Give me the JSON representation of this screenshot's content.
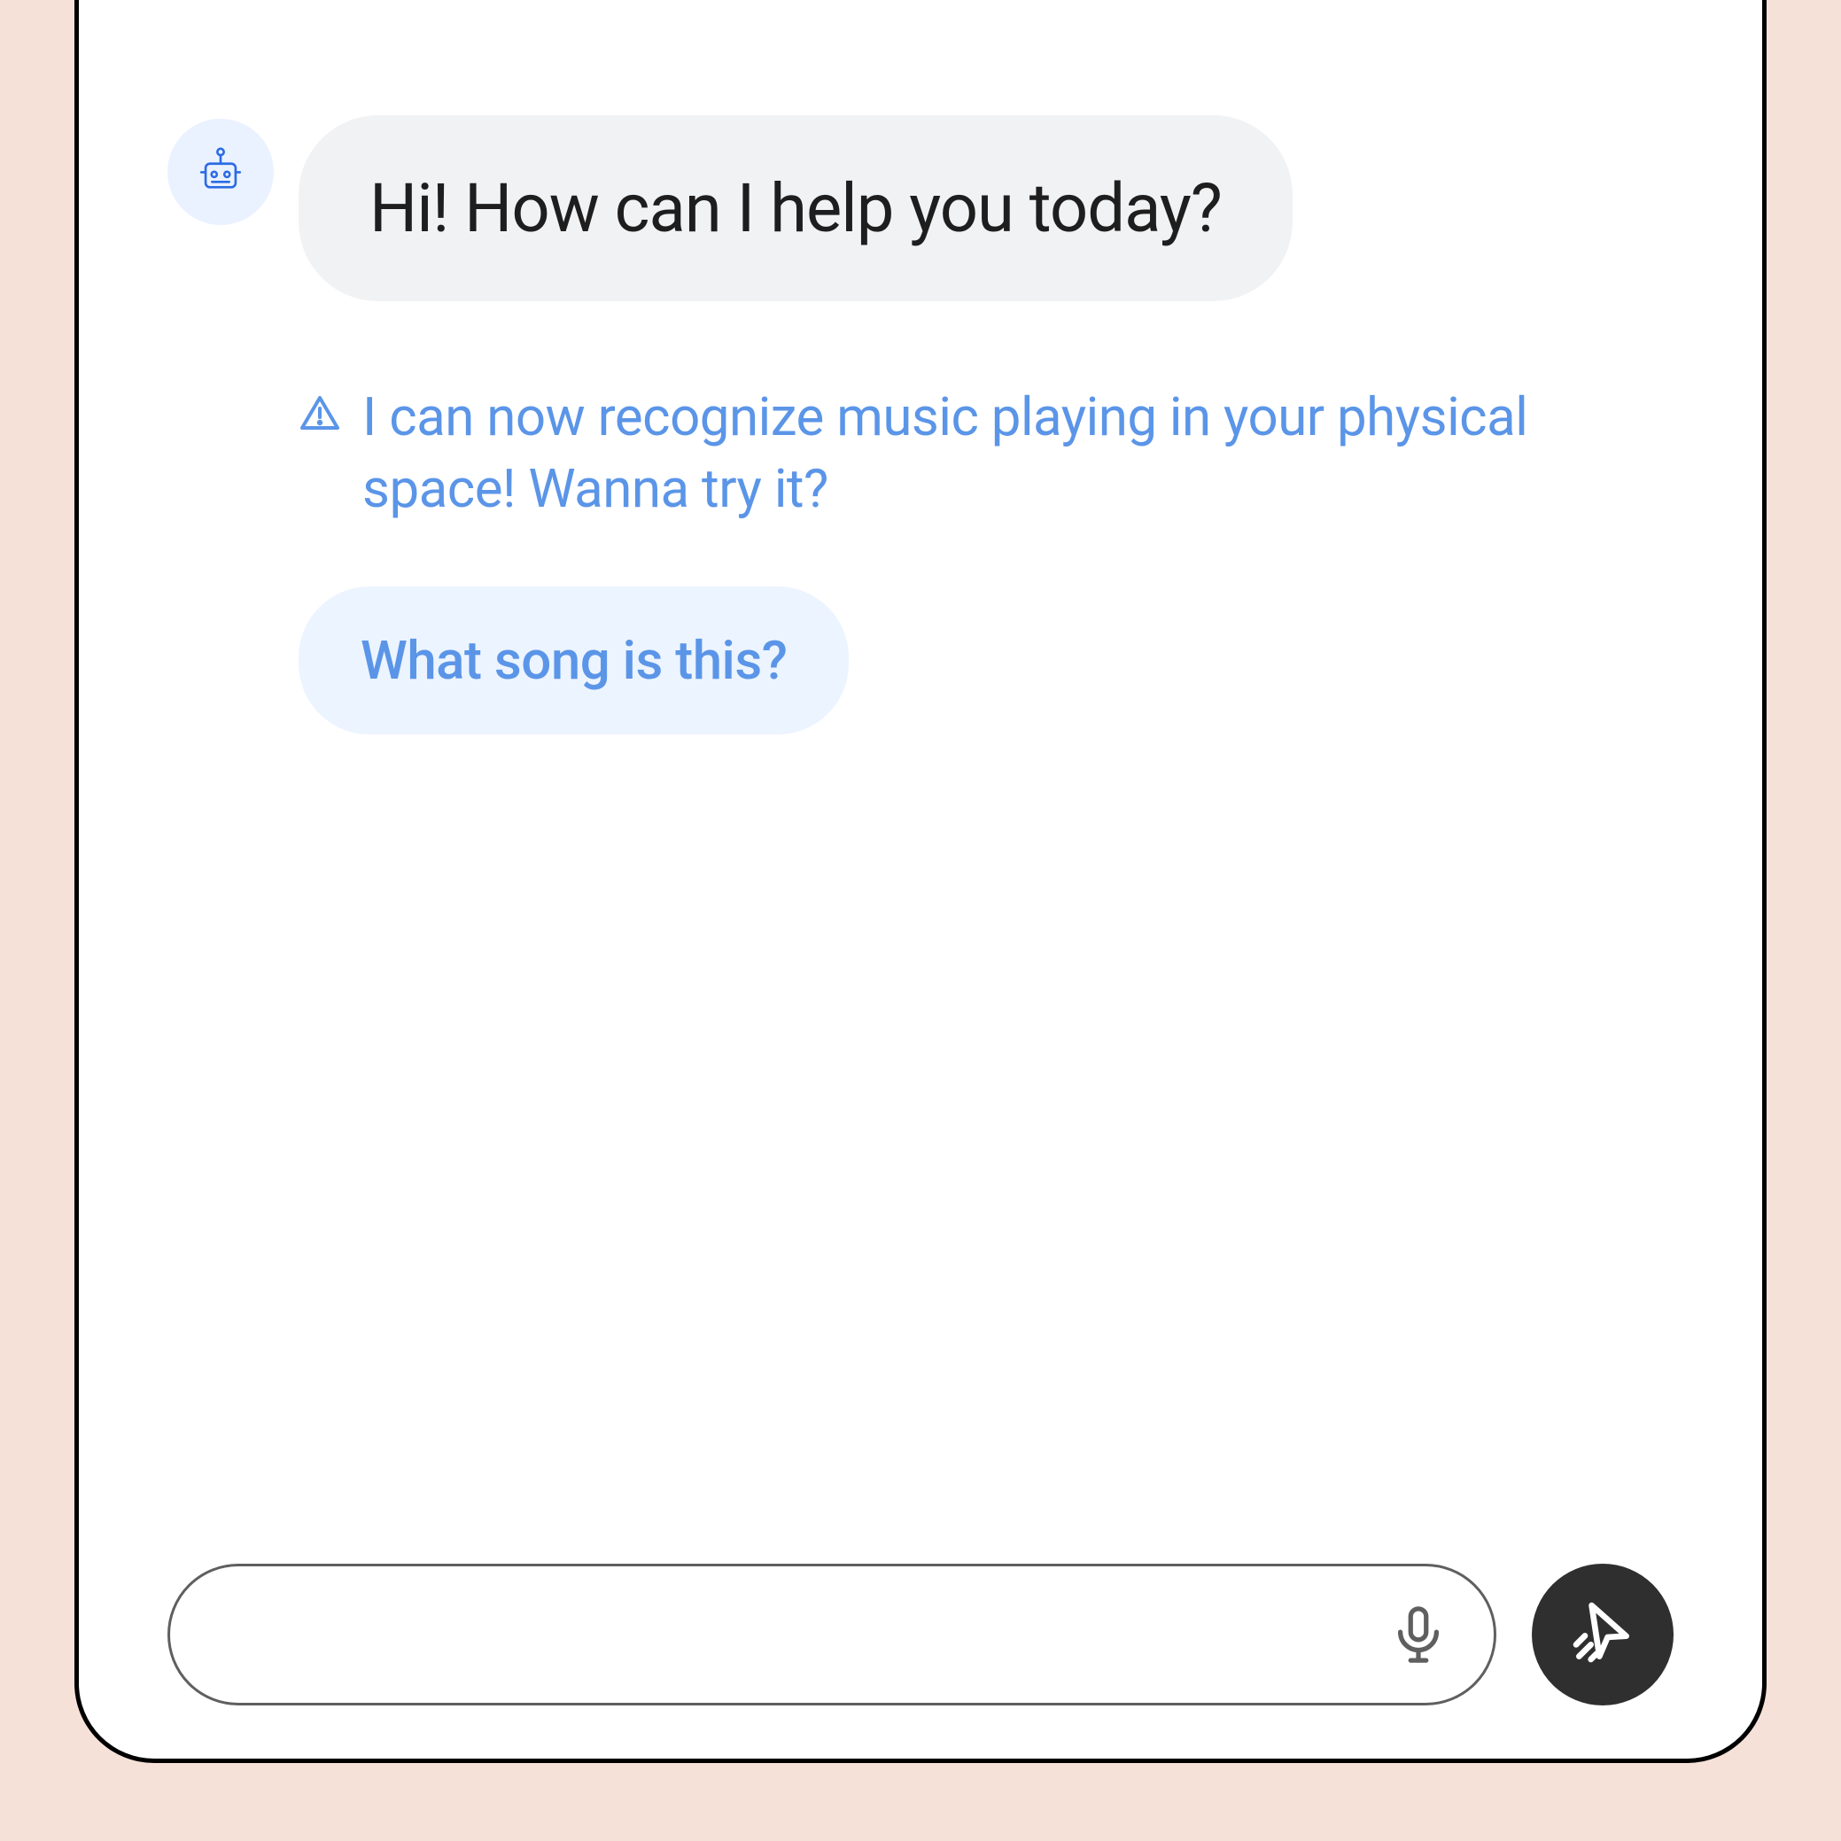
{
  "messages": {
    "bot_greeting": "Hi! How can I help you today?"
  },
  "notice": {
    "text": "I can now recognize music playing in your physical space! Wanna try it?"
  },
  "suggestion": {
    "label": "What song is this?"
  },
  "input": {
    "value": "",
    "placeholder": ""
  },
  "colors": {
    "accent_blue": "#5b95e8",
    "light_blue_bg": "#ecf4ff",
    "avatar_bg": "#eaf2ff",
    "bubble_grey": "#f1f2f4",
    "send_bg": "#2f2f2f",
    "page_bg": "#f6e1d8"
  }
}
